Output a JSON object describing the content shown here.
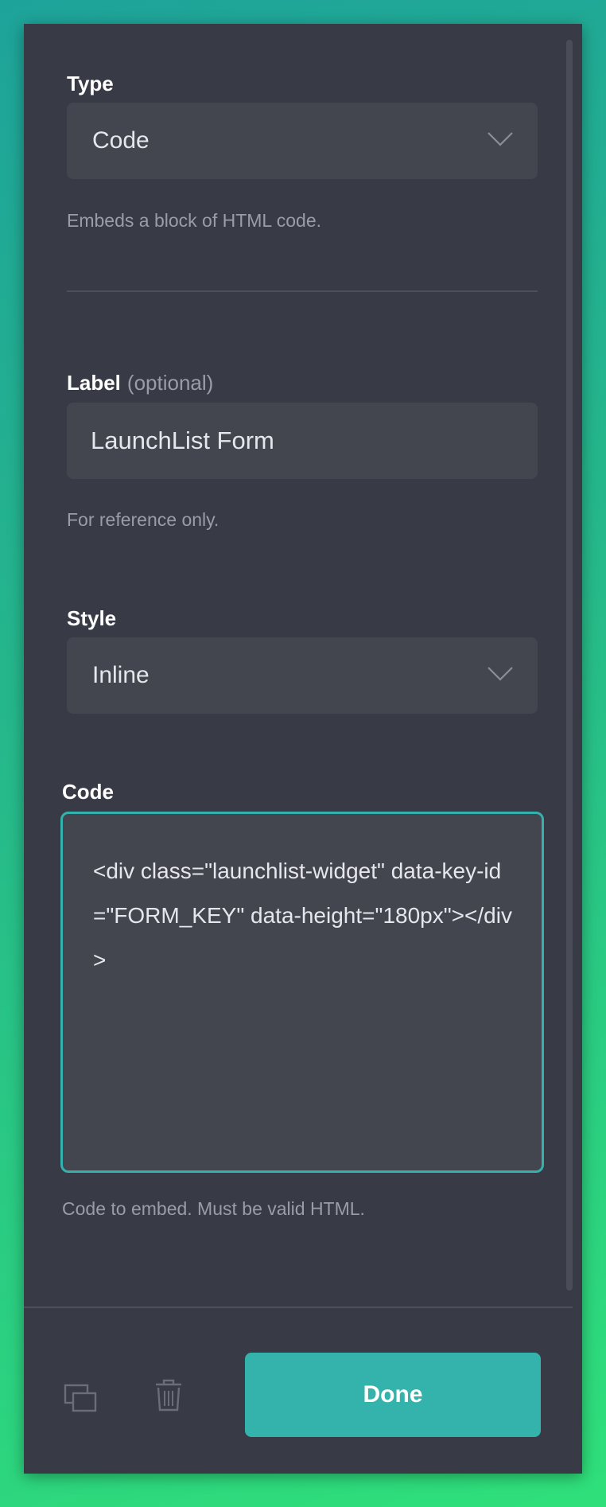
{
  "type_field": {
    "label": "Type",
    "value": "Code",
    "help": "Embeds a block of HTML code."
  },
  "label_field": {
    "label": "Label",
    "optional": "(optional)",
    "value": "LaunchList Form",
    "help": "For reference only."
  },
  "style_field": {
    "label": "Style",
    "value": "Inline"
  },
  "code_field": {
    "label": "Code",
    "value": "<div class=\"launchlist-widget\" data-key-id=\"FORM_KEY\" data-height=\"180px\"></div>",
    "help": "Code to embed. Must be valid HTML."
  },
  "footer": {
    "duplicate_icon": "duplicate-icon",
    "delete_icon": "trash-icon",
    "done_label": "Done"
  },
  "colors": {
    "panel_bg": "#383a45",
    "input_bg": "#43454f",
    "accent": "#35b1ad",
    "button": "#34b3ac"
  }
}
